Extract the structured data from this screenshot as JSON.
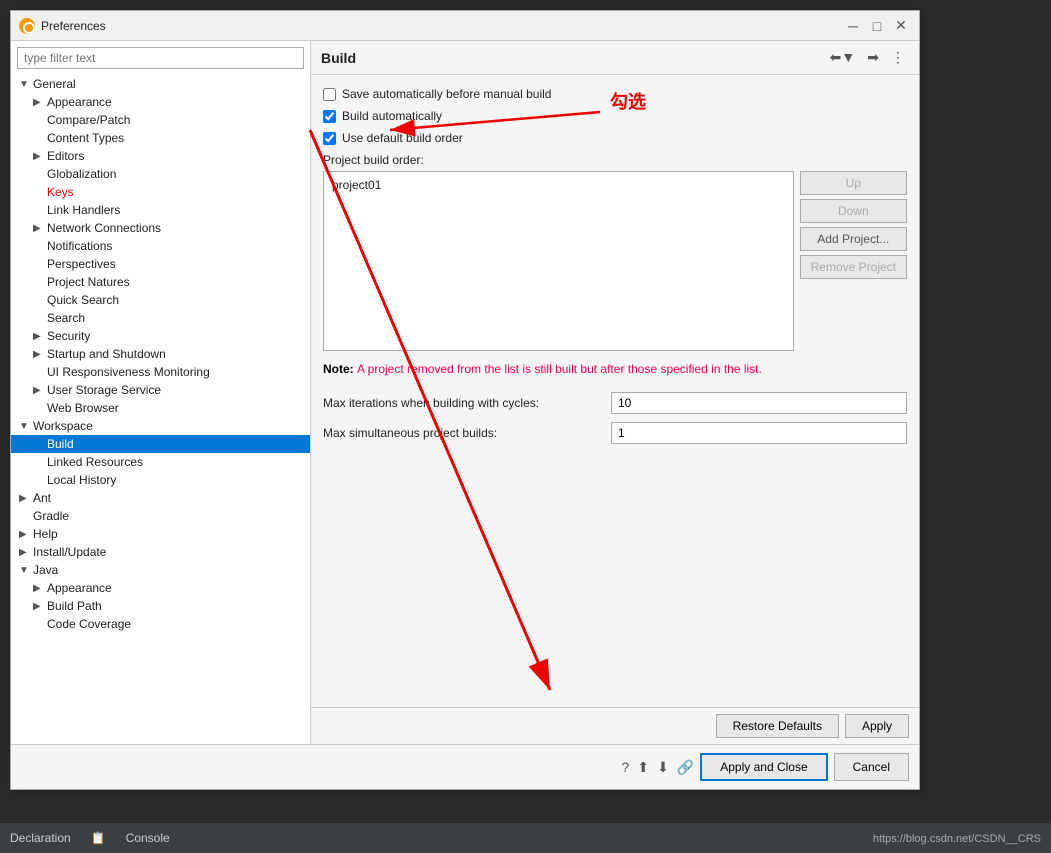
{
  "window": {
    "title": "Preferences",
    "icon": "preferences-icon"
  },
  "sidebar": {
    "filter_placeholder": "type filter text",
    "items": [
      {
        "id": "general",
        "label": "General",
        "indent": 0,
        "arrow": "▼",
        "expanded": true
      },
      {
        "id": "appearance",
        "label": "Appearance",
        "indent": 1,
        "arrow": "▶",
        "expanded": false
      },
      {
        "id": "compare-patch",
        "label": "Compare/Patch",
        "indent": 1,
        "arrow": "",
        "expanded": false
      },
      {
        "id": "content-types",
        "label": "Content Types",
        "indent": 1,
        "arrow": "",
        "expanded": false
      },
      {
        "id": "editors",
        "label": "Editors",
        "indent": 1,
        "arrow": "▶",
        "expanded": false
      },
      {
        "id": "globalization",
        "label": "Globalization",
        "indent": 1,
        "arrow": "",
        "expanded": false
      },
      {
        "id": "keys",
        "label": "Keys",
        "indent": 1,
        "arrow": "",
        "expanded": false,
        "color": "red"
      },
      {
        "id": "link-handlers",
        "label": "Link Handlers",
        "indent": 1,
        "arrow": "",
        "expanded": false
      },
      {
        "id": "network-connections",
        "label": "Network Connections",
        "indent": 1,
        "arrow": "▶",
        "expanded": false
      },
      {
        "id": "notifications",
        "label": "Notifications",
        "indent": 1,
        "arrow": "",
        "expanded": false
      },
      {
        "id": "perspectives",
        "label": "Perspectives",
        "indent": 1,
        "arrow": "",
        "expanded": false
      },
      {
        "id": "project-natures",
        "label": "Project Natures",
        "indent": 1,
        "arrow": "",
        "expanded": false
      },
      {
        "id": "quick-search",
        "label": "Quick Search",
        "indent": 1,
        "arrow": "",
        "expanded": false
      },
      {
        "id": "search",
        "label": "Search",
        "indent": 1,
        "arrow": "",
        "expanded": false
      },
      {
        "id": "security",
        "label": "Security",
        "indent": 1,
        "arrow": "▶",
        "expanded": false
      },
      {
        "id": "startup-shutdown",
        "label": "Startup and Shutdown",
        "indent": 1,
        "arrow": "▶",
        "expanded": false
      },
      {
        "id": "ui-responsiveness",
        "label": "UI Responsiveness Monitoring",
        "indent": 1,
        "arrow": "",
        "expanded": false
      },
      {
        "id": "user-storage",
        "label": "User Storage Service",
        "indent": 1,
        "arrow": "▶",
        "expanded": false
      },
      {
        "id": "web-browser",
        "label": "Web Browser",
        "indent": 1,
        "arrow": "",
        "expanded": false
      },
      {
        "id": "workspace",
        "label": "Workspace",
        "indent": 0,
        "arrow": "▼",
        "expanded": true
      },
      {
        "id": "build",
        "label": "Build",
        "indent": 1,
        "arrow": "",
        "expanded": false,
        "selected": true
      },
      {
        "id": "linked-resources",
        "label": "Linked Resources",
        "indent": 1,
        "arrow": "",
        "expanded": false
      },
      {
        "id": "local-history",
        "label": "Local History",
        "indent": 1,
        "arrow": "",
        "expanded": false
      },
      {
        "id": "ant",
        "label": "Ant",
        "indent": 0,
        "arrow": "▶",
        "expanded": false
      },
      {
        "id": "gradle",
        "label": "Gradle",
        "indent": 0,
        "arrow": "",
        "expanded": false
      },
      {
        "id": "help",
        "label": "Help",
        "indent": 0,
        "arrow": "▶",
        "expanded": false
      },
      {
        "id": "install-update",
        "label": "Install/Update",
        "indent": 0,
        "arrow": "▶",
        "expanded": false
      },
      {
        "id": "java",
        "label": "Java",
        "indent": 0,
        "arrow": "▼",
        "expanded": true
      },
      {
        "id": "java-appearance",
        "label": "Appearance",
        "indent": 1,
        "arrow": "▶",
        "expanded": false
      },
      {
        "id": "build-path",
        "label": "Build Path",
        "indent": 1,
        "arrow": "▶",
        "expanded": false
      },
      {
        "id": "code-coverage",
        "label": "Code Coverage",
        "indent": 1,
        "arrow": "",
        "expanded": false
      }
    ]
  },
  "panel": {
    "title": "Build",
    "checkboxes": [
      {
        "id": "save-auto",
        "label": "Save automatically before manual build",
        "checked": false
      },
      {
        "id": "build-auto",
        "label": "Build automatically",
        "checked": true
      }
    ],
    "use_default_build_order": {
      "label": "Use default build order",
      "checked": true
    },
    "project_build_order_label": "Project build order:",
    "projects": [
      "project01"
    ],
    "order_buttons": [
      {
        "id": "up-btn",
        "label": "Up",
        "disabled": true
      },
      {
        "id": "down-btn",
        "label": "Down",
        "disabled": true
      },
      {
        "id": "add-project-btn",
        "label": "Add Project...",
        "disabled": false
      },
      {
        "id": "remove-project-btn",
        "label": "Remove Project",
        "disabled": true
      }
    ],
    "note": {
      "prefix": "Note: ",
      "text": "A project removed from the list is still built but after those specified in the list."
    },
    "fields": [
      {
        "id": "max-iterations",
        "label": "Max iterations when building with cycles:",
        "value": "10"
      },
      {
        "id": "max-simultaneous",
        "label": "Max simultaneous project builds:",
        "value": "1"
      }
    ],
    "action_buttons": [
      {
        "id": "restore-defaults-btn",
        "label": "Restore Defaults"
      },
      {
        "id": "apply-btn",
        "label": "Apply"
      }
    ]
  },
  "dialog_buttons": [
    {
      "id": "apply-close-btn",
      "label": "Apply and Close",
      "primary": true
    },
    {
      "id": "cancel-btn",
      "label": "Cancel",
      "primary": false
    }
  ],
  "footer": {
    "icons": [
      "help-icon",
      "export-icon",
      "import-icon",
      "link-icon"
    ]
  },
  "annotation": {
    "text": "勾选",
    "color": "#e00"
  },
  "ide_bottom_tabs": [
    {
      "id": "declaration-tab",
      "label": "Declaration"
    },
    {
      "id": "console-tab",
      "label": "Console"
    }
  ],
  "ide_url": "https://blog.csdn.net/CSDN__CRS"
}
